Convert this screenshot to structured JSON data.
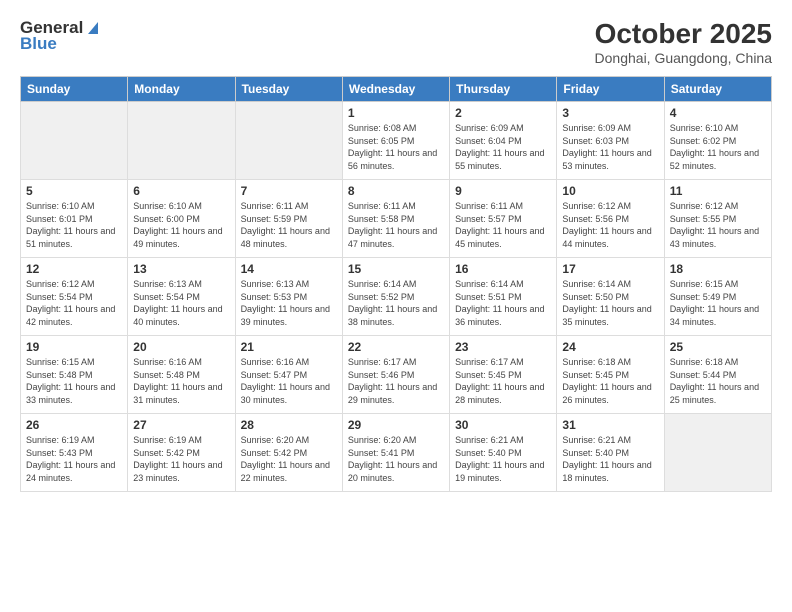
{
  "header": {
    "logo_general": "General",
    "logo_blue": "Blue",
    "title": "October 2025",
    "subtitle": "Donghai, Guangdong, China"
  },
  "days_of_week": [
    "Sunday",
    "Monday",
    "Tuesday",
    "Wednesday",
    "Thursday",
    "Friday",
    "Saturday"
  ],
  "weeks": [
    [
      {
        "day": "",
        "info": ""
      },
      {
        "day": "",
        "info": ""
      },
      {
        "day": "",
        "info": ""
      },
      {
        "day": "1",
        "info": "Sunrise: 6:08 AM\nSunset: 6:05 PM\nDaylight: 11 hours and 56 minutes."
      },
      {
        "day": "2",
        "info": "Sunrise: 6:09 AM\nSunset: 6:04 PM\nDaylight: 11 hours and 55 minutes."
      },
      {
        "day": "3",
        "info": "Sunrise: 6:09 AM\nSunset: 6:03 PM\nDaylight: 11 hours and 53 minutes."
      },
      {
        "day": "4",
        "info": "Sunrise: 6:10 AM\nSunset: 6:02 PM\nDaylight: 11 hours and 52 minutes."
      }
    ],
    [
      {
        "day": "5",
        "info": "Sunrise: 6:10 AM\nSunset: 6:01 PM\nDaylight: 11 hours and 51 minutes."
      },
      {
        "day": "6",
        "info": "Sunrise: 6:10 AM\nSunset: 6:00 PM\nDaylight: 11 hours and 49 minutes."
      },
      {
        "day": "7",
        "info": "Sunrise: 6:11 AM\nSunset: 5:59 PM\nDaylight: 11 hours and 48 minutes."
      },
      {
        "day": "8",
        "info": "Sunrise: 6:11 AM\nSunset: 5:58 PM\nDaylight: 11 hours and 47 minutes."
      },
      {
        "day": "9",
        "info": "Sunrise: 6:11 AM\nSunset: 5:57 PM\nDaylight: 11 hours and 45 minutes."
      },
      {
        "day": "10",
        "info": "Sunrise: 6:12 AM\nSunset: 5:56 PM\nDaylight: 11 hours and 44 minutes."
      },
      {
        "day": "11",
        "info": "Sunrise: 6:12 AM\nSunset: 5:55 PM\nDaylight: 11 hours and 43 minutes."
      }
    ],
    [
      {
        "day": "12",
        "info": "Sunrise: 6:12 AM\nSunset: 5:54 PM\nDaylight: 11 hours and 42 minutes."
      },
      {
        "day": "13",
        "info": "Sunrise: 6:13 AM\nSunset: 5:54 PM\nDaylight: 11 hours and 40 minutes."
      },
      {
        "day": "14",
        "info": "Sunrise: 6:13 AM\nSunset: 5:53 PM\nDaylight: 11 hours and 39 minutes."
      },
      {
        "day": "15",
        "info": "Sunrise: 6:14 AM\nSunset: 5:52 PM\nDaylight: 11 hours and 38 minutes."
      },
      {
        "day": "16",
        "info": "Sunrise: 6:14 AM\nSunset: 5:51 PM\nDaylight: 11 hours and 36 minutes."
      },
      {
        "day": "17",
        "info": "Sunrise: 6:14 AM\nSunset: 5:50 PM\nDaylight: 11 hours and 35 minutes."
      },
      {
        "day": "18",
        "info": "Sunrise: 6:15 AM\nSunset: 5:49 PM\nDaylight: 11 hours and 34 minutes."
      }
    ],
    [
      {
        "day": "19",
        "info": "Sunrise: 6:15 AM\nSunset: 5:48 PM\nDaylight: 11 hours and 33 minutes."
      },
      {
        "day": "20",
        "info": "Sunrise: 6:16 AM\nSunset: 5:48 PM\nDaylight: 11 hours and 31 minutes."
      },
      {
        "day": "21",
        "info": "Sunrise: 6:16 AM\nSunset: 5:47 PM\nDaylight: 11 hours and 30 minutes."
      },
      {
        "day": "22",
        "info": "Sunrise: 6:17 AM\nSunset: 5:46 PM\nDaylight: 11 hours and 29 minutes."
      },
      {
        "day": "23",
        "info": "Sunrise: 6:17 AM\nSunset: 5:45 PM\nDaylight: 11 hours and 28 minutes."
      },
      {
        "day": "24",
        "info": "Sunrise: 6:18 AM\nSunset: 5:45 PM\nDaylight: 11 hours and 26 minutes."
      },
      {
        "day": "25",
        "info": "Sunrise: 6:18 AM\nSunset: 5:44 PM\nDaylight: 11 hours and 25 minutes."
      }
    ],
    [
      {
        "day": "26",
        "info": "Sunrise: 6:19 AM\nSunset: 5:43 PM\nDaylight: 11 hours and 24 minutes."
      },
      {
        "day": "27",
        "info": "Sunrise: 6:19 AM\nSunset: 5:42 PM\nDaylight: 11 hours and 23 minutes."
      },
      {
        "day": "28",
        "info": "Sunrise: 6:20 AM\nSunset: 5:42 PM\nDaylight: 11 hours and 22 minutes."
      },
      {
        "day": "29",
        "info": "Sunrise: 6:20 AM\nSunset: 5:41 PM\nDaylight: 11 hours and 20 minutes."
      },
      {
        "day": "30",
        "info": "Sunrise: 6:21 AM\nSunset: 5:40 PM\nDaylight: 11 hours and 19 minutes."
      },
      {
        "day": "31",
        "info": "Sunrise: 6:21 AM\nSunset: 5:40 PM\nDaylight: 11 hours and 18 minutes."
      },
      {
        "day": "",
        "info": ""
      }
    ]
  ]
}
